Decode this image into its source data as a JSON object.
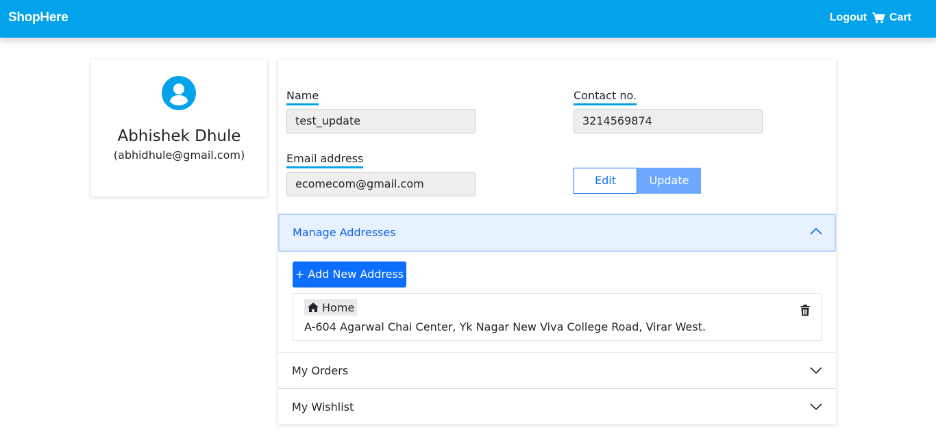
{
  "navbar": {
    "brand": "ShopHere",
    "logout_label": "Logout",
    "cart_label": "Cart",
    "cart_icon": "shopping-cart-icon"
  },
  "profile": {
    "avatar_icon": "user-circle-icon",
    "name": "Abhishek Dhule",
    "email": "(abhidhule@gmail.com)"
  },
  "form": {
    "name_label": "Name",
    "name_value": "test_update",
    "contact_label": "Contact no.",
    "contact_value": "3214569874",
    "email_label": "Email address",
    "email_value": "ecomecom@gmail.com",
    "edit_label": "Edit",
    "update_label": "Update"
  },
  "accordion": {
    "addresses": {
      "title": "Manage Addresses",
      "expanded": true,
      "add_button_label": "+ Add New Address",
      "items": [
        {
          "type_label": "Home",
          "type_icon": "home-icon",
          "address": "A-604 Agarwal Chai Center, Yk Nagar New Viva College Road, Virar West.",
          "delete_icon": "trash-icon"
        }
      ]
    },
    "orders": {
      "title": "My Orders",
      "expanded": false
    },
    "wishlist": {
      "title": "My Wishlist",
      "expanded": false
    }
  },
  "colors": {
    "navbar_bg": "#02a3ea",
    "primary": "#0d6efd",
    "update_button": "#6ea8fe",
    "accordion_active_bg": "#e7f1ff",
    "accordion_active_text": "#0c63e4"
  }
}
